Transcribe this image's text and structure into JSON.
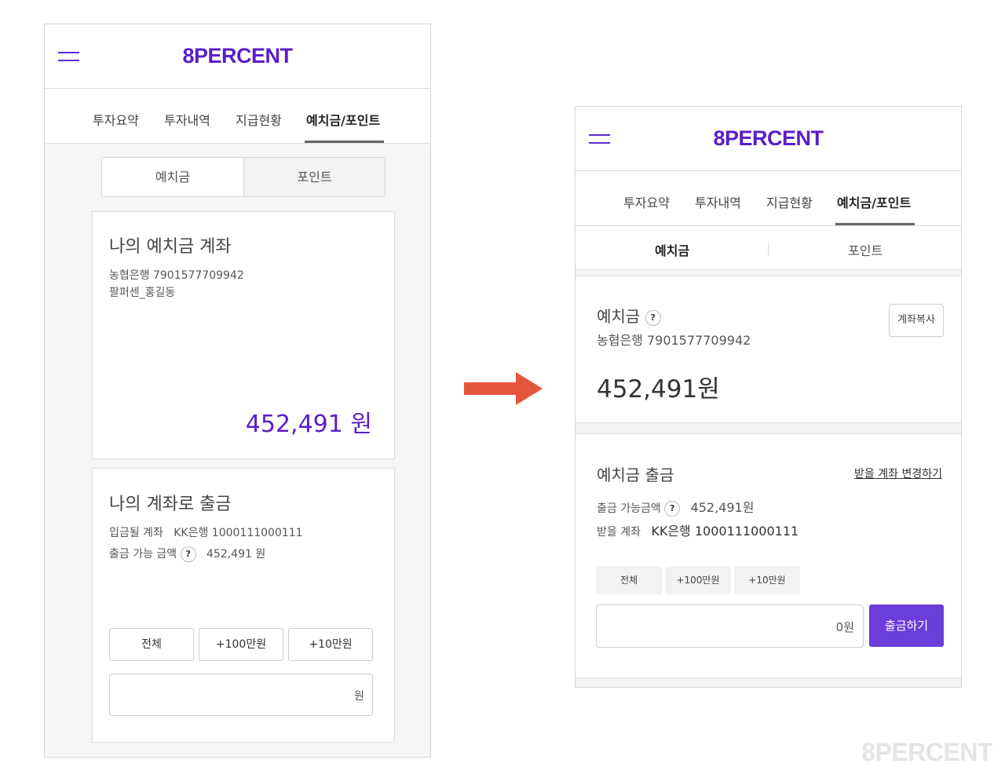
{
  "brand": {
    "logo": "8PERCENT",
    "accent": "#5a1ec8",
    "button_color": "#6b3ed9",
    "arrow_color": "#e4553d"
  },
  "tabs": [
    "투자요약",
    "투자내역",
    "지급현황",
    "예치금/포인트"
  ],
  "active_tab": "예치금/포인트",
  "left": {
    "segments": [
      "예치금",
      "포인트"
    ],
    "deposit_card": {
      "title": "나의 예치금 계좌",
      "account": "농협은행 7901577709942",
      "holder": "팔퍼센_홍길동",
      "amount": "452,491 원"
    },
    "withdraw_card": {
      "title": "나의 계좌로 출금",
      "dest_label": "입금될 계좌",
      "dest_value": "KK은행 1000111000111",
      "avail_label": "출금 가능 금액",
      "avail_value": "452,491 원",
      "help": "?",
      "quick_buttons": [
        "전체",
        "+100만원",
        "+10만원"
      ],
      "input_unit": "원"
    }
  },
  "right": {
    "subtabs": [
      "예치금",
      "포인트"
    ],
    "deposit_card": {
      "title": "예치금",
      "help": "?",
      "account": "농협은행 7901577709942",
      "copy_button": "계좌복사",
      "amount": "452,491원"
    },
    "withdraw_card": {
      "title": "예치금 출금",
      "change_link": "받을 계좌 변경하기",
      "avail_label": "출금 가능금액",
      "help": "?",
      "avail_value": "452,491원",
      "dest_label": "받을 계좌",
      "dest_value": "KK은행 1000111000111",
      "quick_buttons": [
        "전체",
        "+100만원",
        "+10만원"
      ],
      "input_value": "0원",
      "submit": "출금하기"
    }
  },
  "watermark": "8PERCENT"
}
